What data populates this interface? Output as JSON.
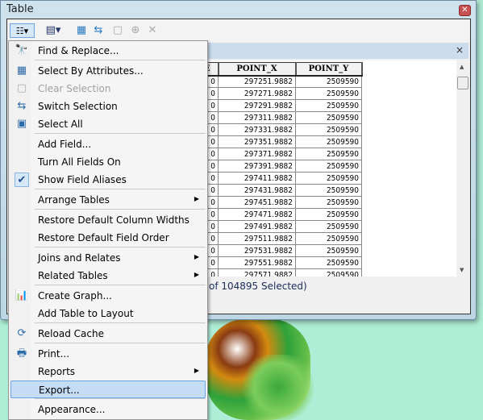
{
  "window": {
    "title": "Table",
    "close": "✕"
  },
  "toolbar": {
    "icons": [
      "table-options-icon",
      "dropdown-arrow-icon",
      "related-tables-icon",
      "dropdown-arrow-icon",
      "select-by-attributes-icon",
      "switch-selection-icon",
      "clear-selection-icon",
      "zoom-to-selected-icon",
      "delete-selected-icon"
    ]
  },
  "table_tab": {
    "close": "×"
  },
  "grid": {
    "columns": [
      "D_CODE",
      "POINT_X",
      "POINT_Y"
    ],
    "rows": [
      [
        "0",
        "297251.9882",
        "2509590"
      ],
      [
        "0",
        "297271.9882",
        "2509590"
      ],
      [
        "0",
        "297291.9882",
        "2509590"
      ],
      [
        "0",
        "297311.9882",
        "2509590"
      ],
      [
        "0",
        "297331.9882",
        "2509590"
      ],
      [
        "0",
        "297351.9882",
        "2509590"
      ],
      [
        "0",
        "297371.9882",
        "2509590"
      ],
      [
        "0",
        "297391.9882",
        "2509590"
      ],
      [
        "0",
        "297411.9882",
        "2509590"
      ],
      [
        "0",
        "297431.9882",
        "2509590"
      ],
      [
        "0",
        "297451.9882",
        "2509590"
      ],
      [
        "0",
        "297471.9882",
        "2509590"
      ],
      [
        "0",
        "297491.9882",
        "2509590"
      ],
      [
        "0",
        "297511.9882",
        "2509590"
      ],
      [
        "0",
        "297531.9882",
        "2509590"
      ],
      [
        "0",
        "297551.9882",
        "2509590"
      ],
      [
        "0",
        "297571.9882",
        "2509590"
      ]
    ]
  },
  "status": {
    "text": "of 104895 Selected)"
  },
  "menu": {
    "items": [
      {
        "label": "Find & Replace...",
        "icon": "binoculars-icon",
        "glyph": "🔭"
      },
      {
        "label": "Select By Attributes...",
        "icon": "select-by-attributes-icon",
        "glyph": "▦"
      },
      {
        "label": "Clear Selection",
        "icon": "clear-selection-icon",
        "glyph": "▢",
        "disabled": true
      },
      {
        "label": "Switch Selection",
        "icon": "switch-selection-icon",
        "glyph": "⇆"
      },
      {
        "label": "Select All",
        "icon": "select-all-icon",
        "glyph": "▣"
      },
      {
        "label": "Add Field..."
      },
      {
        "label": "Turn All Fields On"
      },
      {
        "label": "Show Field Aliases",
        "icon": "checkmark-icon",
        "glyph": "✔",
        "checked": true
      },
      {
        "label": "Arrange Tables",
        "submenu": true
      },
      {
        "label": "Restore Default Column Widths"
      },
      {
        "label": "Restore Default Field Order"
      },
      {
        "label": "Joins and Relates",
        "submenu": true
      },
      {
        "label": "Related Tables",
        "submenu": true
      },
      {
        "label": "Create Graph...",
        "icon": "bar-chart-icon",
        "glyph": "📊"
      },
      {
        "label": "Add Table to Layout"
      },
      {
        "label": "Reload Cache",
        "icon": "refresh-icon",
        "glyph": "⟳"
      },
      {
        "label": "Print...",
        "icon": "printer-icon",
        "glyph": "🖶"
      },
      {
        "label": "Reports",
        "submenu": true
      },
      {
        "label": "Export...",
        "highlighted": true
      },
      {
        "label": "Appearance..."
      }
    ]
  }
}
